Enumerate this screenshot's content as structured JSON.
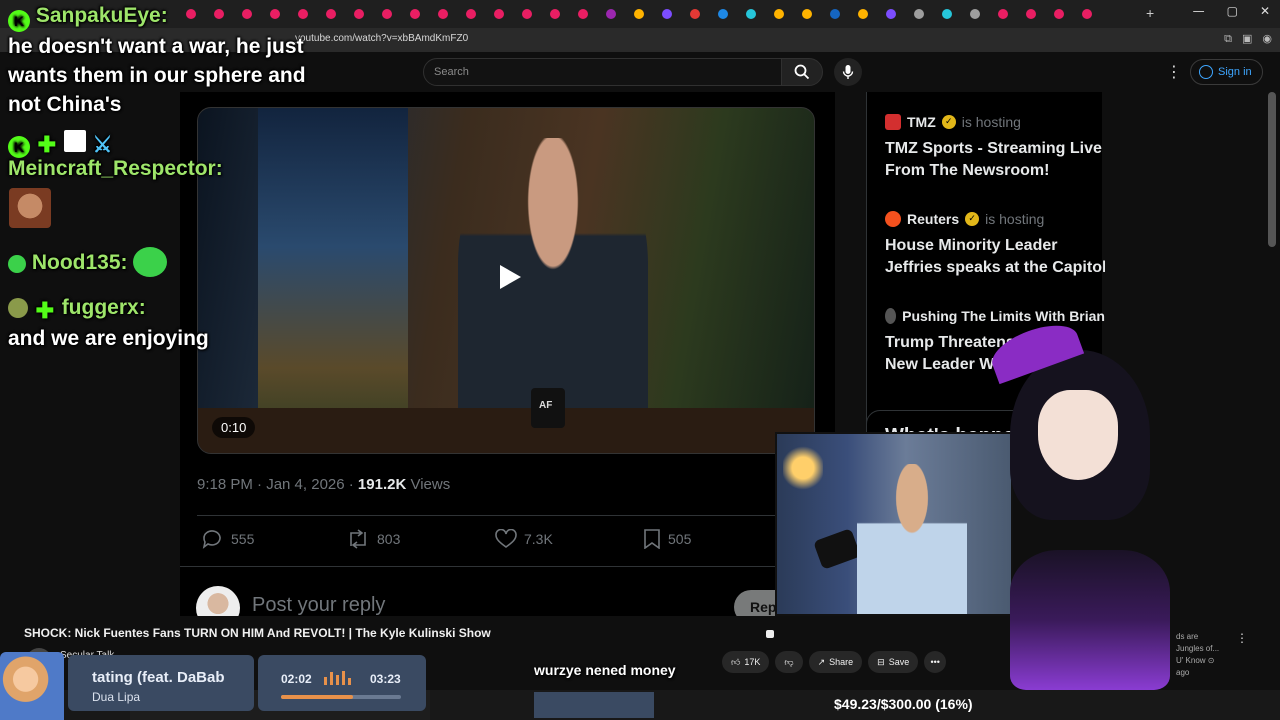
{
  "browser": {
    "url": "youtube.com/watch?v=xbBAmdKmFZ0",
    "new_tab_glyph": "+",
    "window_controls": [
      "—",
      "▢",
      "✕"
    ],
    "tab_favicon_colors": [
      "#e91e63",
      "#e91e63",
      "#e91e63",
      "#e91e63",
      "#e91e63",
      "#e91e63",
      "#e91e63",
      "#e91e63",
      "#e91e63",
      "#e91e63",
      "#e91e63",
      "#e91e63",
      "#e91e63",
      "#e91e63",
      "#e91e63",
      "#9c27b0",
      "#ffb300",
      "#7c4dff",
      "#e53935",
      "#1e88e5",
      "#26c6da",
      "#ffb300",
      "#ffb300",
      "#1565c0",
      "#ffb300",
      "#7c4dff",
      "#9e9e9e",
      "#26c6da",
      "#9e9e9e",
      "#e91e63",
      "#e91e63",
      "#e91e63",
      "#e91e63"
    ]
  },
  "youtube": {
    "search_placeholder": "Search",
    "sign_in_label": "Sign in",
    "video_title": "SHOCK: Nick Fuentes Fans TURN ON HIM And REVOLT! | The Kyle Kulinski Show",
    "channel_name": "Secular Talk",
    "like_count": "17K",
    "share_label": "Share",
    "save_label": "Save",
    "suggestion_lines": [
      "ds are",
      "Jungles of...",
      "U' Know ⊙",
      "ago"
    ]
  },
  "post": {
    "video_time": "0:10",
    "mug_logo": "AF",
    "timestamp": "9:18 PM · Jan 4, 2026 · ",
    "views_count": "191.2K",
    "views_label": " Views",
    "replies": "555",
    "reposts": "803",
    "likes": "7.3K",
    "bookmarks": "505",
    "reply_placeholder": "Post your reply",
    "reply_button": "Rep"
  },
  "live_sidebar": {
    "hosting_label": "is hosting",
    "items": [
      {
        "host": "TMZ",
        "title_line1": "TMZ Sports - Streaming Live",
        "title_line2": "From The Newsroom!",
        "logo_color": "#d32f2f",
        "verified": true
      },
      {
        "host": "Reuters",
        "title_line1": "House Minority Leader",
        "title_line2": "Jeffries speaks at the Capitol",
        "logo_color": "#f4511e",
        "verified": true
      },
      {
        "host": "Pushing The Limits With Brian",
        "title_line1": "Trump Threatens",
        "title_line2": "New Leader W",
        "logo_color": "#555555",
        "verified": false
      }
    ],
    "whats_happening": "What's happening"
  },
  "chat": {
    "messages": [
      {
        "user": "SanpakuEye:",
        "text": ""
      },
      {
        "user": "",
        "text": "he doesn't want a war, he just"
      },
      {
        "user": "",
        "text": "wants them in our sphere and"
      },
      {
        "user": "",
        "text": "not China's"
      },
      {
        "user": "Meincraft_Respector:",
        "text": ""
      },
      {
        "user": "Nood135:",
        "text": ""
      },
      {
        "user": "fuggerx:",
        "text": ""
      },
      {
        "user": "",
        "text": "and we are enjoying"
      }
    ]
  },
  "overlay": {
    "now_playing_title": "tating (feat. DaBab",
    "now_playing_artist": "Dua Lipa",
    "elapsed": "02:02",
    "total": "03:23",
    "progress_fraction": 0.6,
    "caption": "wurzye nened money",
    "goal_text": "$49.23/$300.00 (16%)",
    "goal_fraction": 0.16
  },
  "colors": {
    "kick_green": "#53fc18",
    "chat_user": "#9ee56a",
    "x_muted": "#71767b",
    "yt_link": "#3ea6ff"
  },
  "icons": {
    "search": "search-icon",
    "mic": "mic-icon",
    "play": "play-icon",
    "reply": "reply-icon",
    "repost": "repost-icon",
    "like": "heart-icon",
    "bookmark": "bookmark-icon"
  }
}
